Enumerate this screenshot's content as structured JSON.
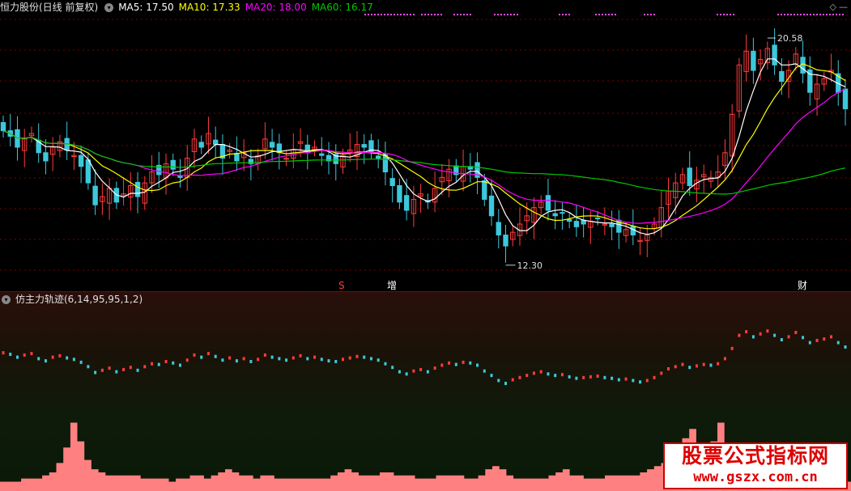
{
  "main_header": {
    "stock_title": "恒力股份(日线 前复权)",
    "ma5": "MA5: 17.50",
    "ma10": "MA10: 17.33",
    "ma20": "MA20: 18.00",
    "ma60": "MA60: 16.17"
  },
  "sub_header": {
    "indicator_title": "仿主力轨迹(6,14,95,95,1,2)"
  },
  "annotations": {
    "high_label": "20.58",
    "low_label": "12.30",
    "marker_s": "S",
    "marker_zeng": "增",
    "marker_cai": "财"
  },
  "watermark": {
    "title": "股票公式指标网",
    "url": "www.gszx.com.cn"
  },
  "colors": {
    "up": "#ff3c3c",
    "down": "#3cc8dc",
    "ma5": "#ffffff",
    "ma10": "#ffff00",
    "ma20": "#ff00ff",
    "ma60": "#00c800",
    "histogram": "#ff8080",
    "grid": "#7a0000"
  },
  "chart_data": [
    {
      "type": "candlestick",
      "title": "恒力股份(日线 前复权)",
      "series": [
        {
          "name": "MA5",
          "value": 17.5
        },
        {
          "name": "MA10",
          "value": 17.33
        },
        {
          "name": "MA20",
          "value": 18.0
        },
        {
          "name": "MA60",
          "value": 16.17
        }
      ],
      "close": [
        17.2,
        17.0,
        16.6,
        16.9,
        17.1,
        16.4,
        16.1,
        16.6,
        16.8,
        16.5,
        16.3,
        15.9,
        15.3,
        14.5,
        14.8,
        15.1,
        14.6,
        14.9,
        15.2,
        14.8,
        15.3,
        15.7,
        15.6,
        16.0,
        15.8,
        15.5,
        16.2,
        16.9,
        16.6,
        17.1,
        16.7,
        16.2,
        16.5,
        16.1,
        16.4,
        16.0,
        16.3,
        16.9,
        16.6,
        16.4,
        16.2,
        16.5,
        16.8,
        16.4,
        16.6,
        16.3,
        16.1,
        16.0,
        16.3,
        16.5,
        16.7,
        16.6,
        16.4,
        16.2,
        15.7,
        15.2,
        14.6,
        14.3,
        14.7,
        14.9,
        14.6,
        15.1,
        15.5,
        15.8,
        15.6,
        15.9,
        15.8,
        15.5,
        14.7,
        14.1,
        13.4,
        13.0,
        13.5,
        13.8,
        14.1,
        14.4,
        14.6,
        14.3,
        14.1,
        14.2,
        13.9,
        13.7,
        13.8,
        13.9,
        14.0,
        13.8,
        13.7,
        13.5,
        13.6,
        13.4,
        13.2,
        13.4,
        13.8,
        14.4,
        15.0,
        15.3,
        15.6,
        15.2,
        15.4,
        15.6,
        15.5,
        15.7,
        16.4,
        17.8,
        19.6,
        20.1,
        19.4,
        19.8,
        20.2,
        19.6,
        19.0,
        19.4,
        20.0,
        19.3,
        18.6,
        18.9,
        19.1,
        19.4,
        18.6,
        18.0
      ],
      "ylabel": "",
      "annotations": [
        "20.58",
        "12.30"
      ]
    },
    {
      "type": "bar",
      "title": "仿主力轨迹(6,14,95,95,1,2)",
      "values": [
        3,
        3,
        3,
        4,
        4,
        4,
        5,
        6,
        9,
        14,
        22,
        16,
        10,
        7,
        6,
        5,
        5,
        5,
        5,
        5,
        4,
        4,
        4,
        4,
        3,
        4,
        4,
        5,
        5,
        4,
        5,
        6,
        7,
        6,
        5,
        5,
        4,
        5,
        5,
        4,
        4,
        4,
        4,
        4,
        4,
        4,
        4,
        5,
        6,
        7,
        6,
        5,
        5,
        5,
        6,
        6,
        5,
        5,
        5,
        4,
        4,
        4,
        5,
        5,
        5,
        5,
        4,
        4,
        5,
        7,
        8,
        7,
        5,
        4,
        4,
        4,
        4,
        4,
        5,
        6,
        7,
        5,
        5,
        4,
        4,
        4,
        5,
        5,
        5,
        5,
        5,
        6,
        7,
        8,
        9,
        11,
        14,
        17,
        20,
        15,
        12,
        16,
        22,
        14,
        9,
        7,
        6,
        5,
        4,
        4,
        5,
        5,
        5,
        5,
        4,
        4,
        4,
        4,
        3,
        3,
        3
      ]
    }
  ]
}
